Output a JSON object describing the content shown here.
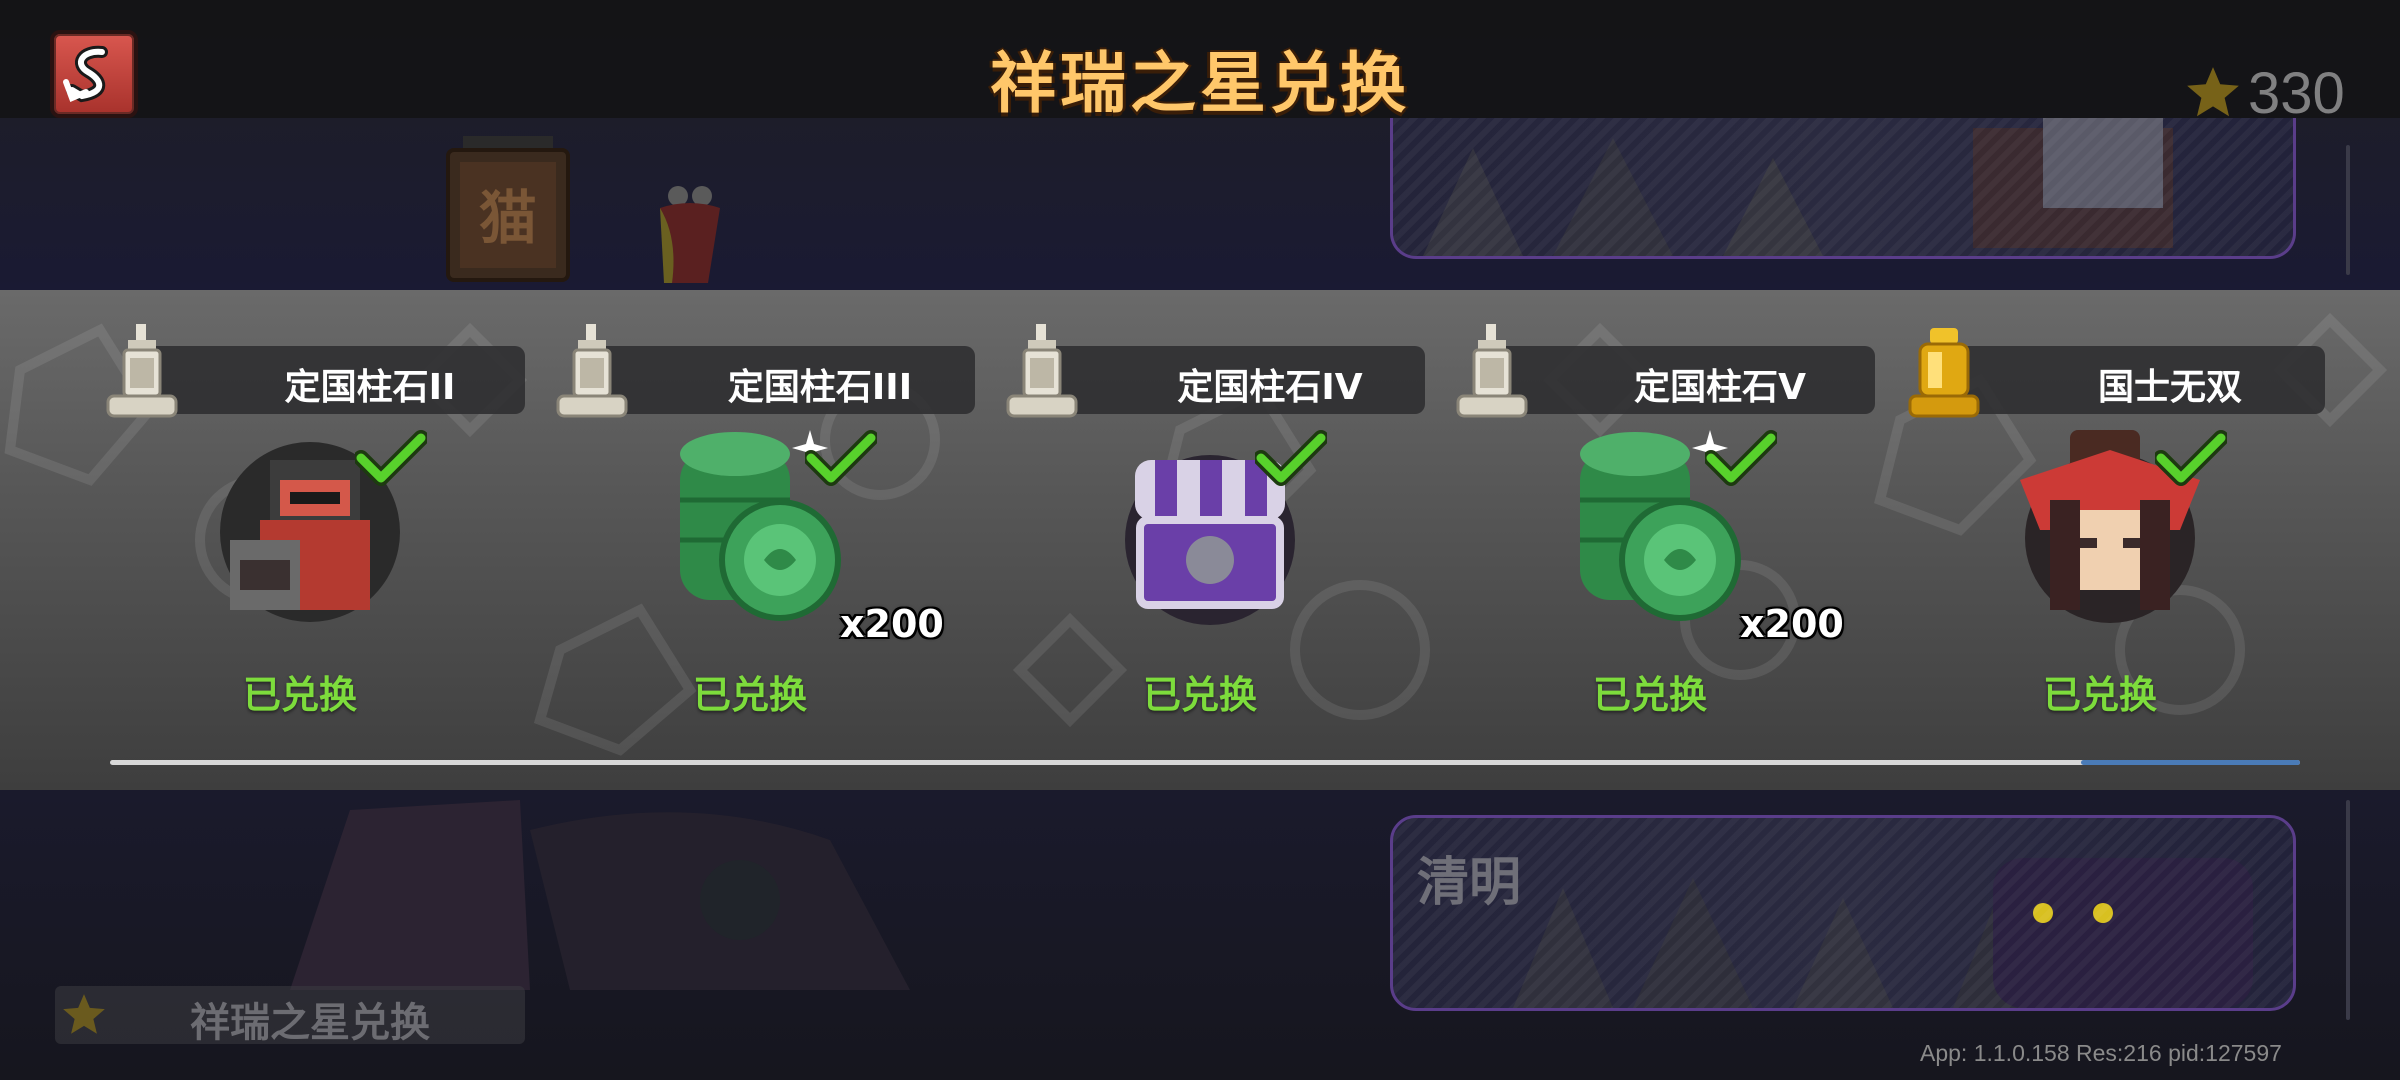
{
  "header": {
    "title": "祥瑞之星兑换",
    "currency_value": "330"
  },
  "background": {
    "banner_bottom_label": "清明",
    "lantern_char": "猫"
  },
  "rewards": [
    {
      "name": "定国柱石II",
      "status": "已兑换",
      "quantity": "",
      "item_icon": "soldier-icon",
      "tier_icon": "pillar-icon"
    },
    {
      "name": "定国柱石III",
      "status": "已兑换",
      "quantity": "x200",
      "item_icon": "jade-coin-icon",
      "tier_icon": "pillar-icon"
    },
    {
      "name": "定国柱石IV",
      "status": "已兑换",
      "quantity": "",
      "item_icon": "purple-chest-icon",
      "tier_icon": "pillar-icon"
    },
    {
      "name": "定国柱石V",
      "status": "已兑换",
      "quantity": "x200",
      "item_icon": "jade-coin-icon",
      "tier_icon": "pillar-icon"
    },
    {
      "name": "国士无双",
      "status": "已兑换",
      "quantity": "",
      "item_icon": "red-hat-hero-icon",
      "tier_icon": "gold-pillar-icon"
    }
  ],
  "scroll": {
    "position": 0.9
  },
  "bottom_tab": {
    "label": "祥瑞之星兑换"
  },
  "footer": {
    "version": "App: 1.1.0.158 Res:216 pid:127597"
  },
  "colors": {
    "title": "#ffc76a",
    "status": "#7ddc3c",
    "back_button": "#c8463f",
    "check": "#58d12c"
  }
}
